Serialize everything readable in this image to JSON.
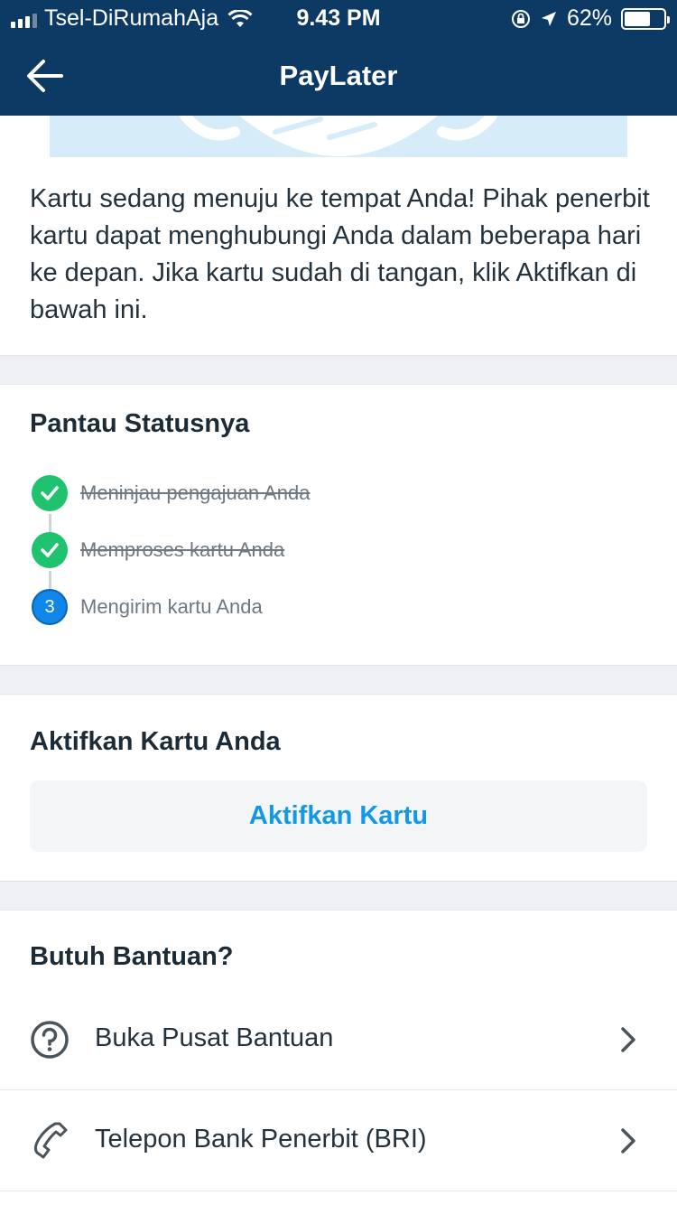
{
  "status_bar": {
    "carrier": "Tsel-DiRumahAja",
    "time": "9.43 PM",
    "battery": "62%",
    "battery_level": 0.62
  },
  "header": {
    "title": "PayLater"
  },
  "intro": {
    "text": "Kartu sedang menuju ke tempat Anda! Pihak penerbit kartu dapat menghubungi Anda dalam beberapa hari ke depan. Jika kartu sudah di tangan, klik Aktifkan di bawah ini."
  },
  "status_section": {
    "title": "Pantau Statusnya",
    "steps": [
      {
        "label": "Meninjau pengajuan Anda",
        "state": "done"
      },
      {
        "label": "Memproses kartu Anda",
        "state": "done"
      },
      {
        "label": "Mengirim kartu Anda",
        "state": "current",
        "number": "3"
      }
    ]
  },
  "activate_section": {
    "title": "Aktifkan Kartu Anda",
    "button_label": "Aktifkan Kartu"
  },
  "help_section": {
    "title": "Butuh Bantuan?",
    "items": [
      {
        "label": "Buka Pusat Bantuan",
        "icon": "question-circle-icon"
      },
      {
        "label": "Telepon Bank Penerbit (BRI)",
        "icon": "phone-icon"
      }
    ]
  },
  "colors": {
    "header_bg": "#0d3a64",
    "done_green": "#1fc36f",
    "current_blue": "#0f86e8",
    "link_blue": "#1398e6"
  }
}
